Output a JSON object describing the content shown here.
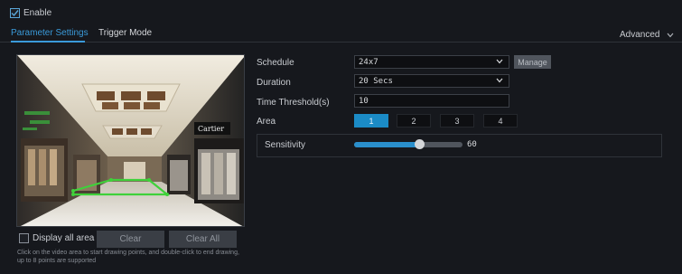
{
  "enable": {
    "label": "Enable",
    "checked": true
  },
  "tabs": [
    {
      "label": "Parameter Settings",
      "active": true
    },
    {
      "label": "Trigger Mode",
      "active": false
    }
  ],
  "advanced": {
    "label": "Advanced"
  },
  "preview": {
    "display_all_area_label": "Display all area",
    "clear_label": "Clear",
    "clear_all_label": "Clear All",
    "hint": "Click on the video area to start drawing points, and double-click to end drawing, up to 8 points are supported",
    "storefront_sign": "Cartier"
  },
  "form": {
    "schedule": {
      "label": "Schedule",
      "value": "24x7",
      "manage_label": "Manage"
    },
    "duration": {
      "label": "Duration",
      "value": "20 Secs"
    },
    "time_threshold": {
      "label": "Time Threshold(s)",
      "value": "10"
    },
    "area": {
      "label": "Area",
      "options": [
        "1",
        "2",
        "3",
        "4"
      ],
      "selected": "1"
    },
    "sensitivity": {
      "label": "Sensitivity",
      "value": "60",
      "level_percent": 60
    }
  },
  "colors": {
    "accent": "#3a9ad9",
    "selected_area": "#1b8bc6",
    "region_outline": "#3fd13a"
  }
}
